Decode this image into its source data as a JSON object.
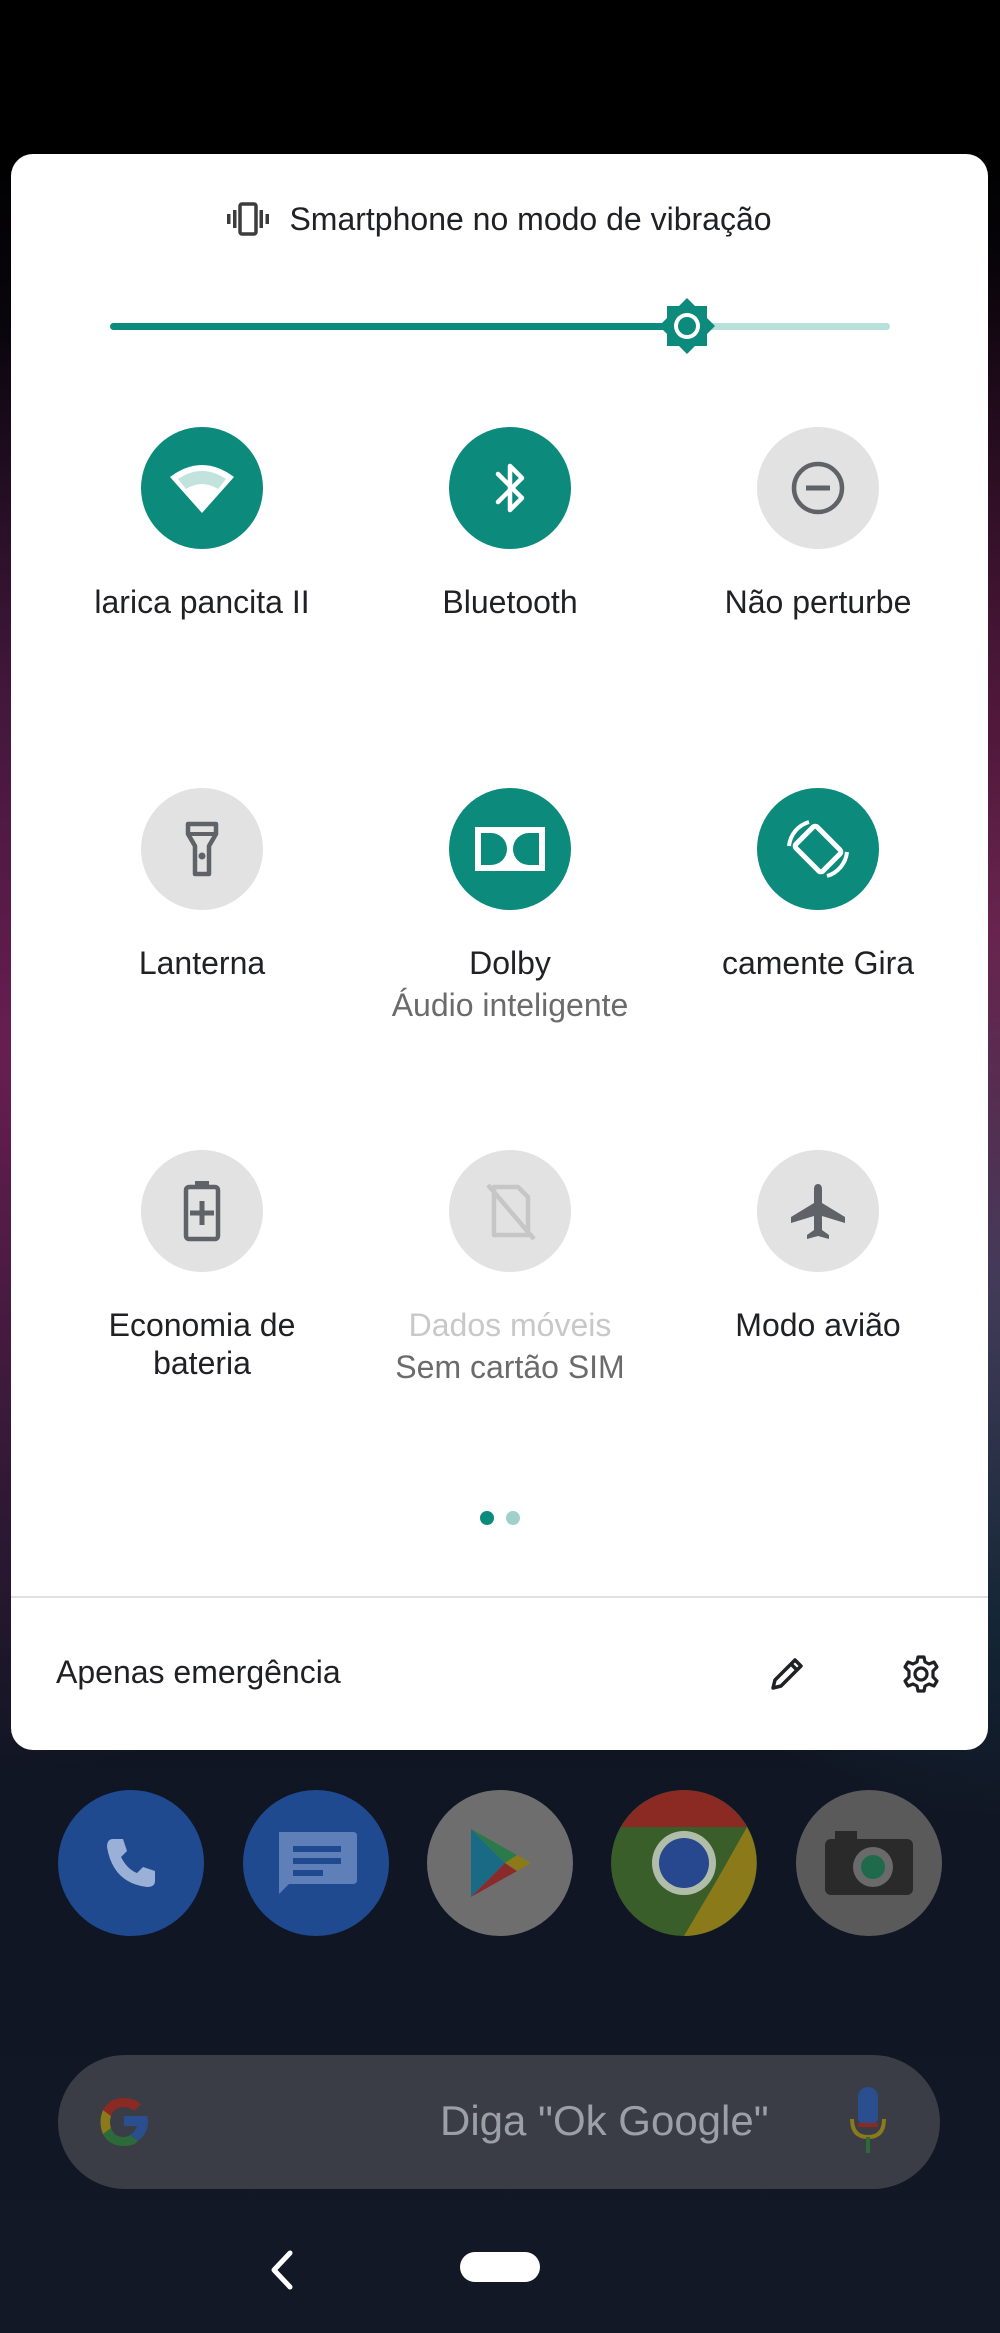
{
  "header": {
    "vibration_text": "Smartphone no modo de vibração",
    "vibration_icon": "vibrate-icon"
  },
  "brightness": {
    "level": 0.74,
    "icon": "brightness-icon"
  },
  "tiles": [
    {
      "label": "larica pancita II",
      "sub": "",
      "state": "on",
      "icon": "wifi-icon"
    },
    {
      "label": "Bluetooth",
      "sub": "",
      "state": "on",
      "icon": "bluetooth-icon"
    },
    {
      "label": "Não perturbe",
      "sub": "",
      "state": "off",
      "icon": "do-not-disturb-icon"
    },
    {
      "label": "Lanterna",
      "sub": "",
      "state": "off",
      "icon": "flashlight-icon"
    },
    {
      "label": "Dolby",
      "sub": "Áudio inteligente",
      "state": "on",
      "icon": "dolby-icon"
    },
    {
      "label": "camente    Gira",
      "sub": "",
      "state": "on",
      "icon": "auto-rotate-icon"
    },
    {
      "label": "Economia de bateria",
      "sub": "",
      "state": "off",
      "icon": "battery-saver-icon"
    },
    {
      "label": "Dados móveis",
      "sub": "Sem cartão SIM",
      "state": "disabled",
      "icon": "mobile-data-off-icon"
    },
    {
      "label": "Modo avião",
      "sub": "",
      "state": "off",
      "icon": "airplane-icon"
    }
  ],
  "pagination": {
    "current": 1,
    "total": 2
  },
  "footer": {
    "text": "Apenas emergência",
    "edit_icon": "edit-icon",
    "settings_icon": "settings-icon"
  },
  "dock": {
    "apps": [
      "phone",
      "messages",
      "play-store",
      "chrome",
      "camera"
    ]
  },
  "search": {
    "hint": "Diga \"Ok Google\""
  },
  "colors": {
    "accent": "#0c8a7c",
    "accent_light": "#b9e1dc",
    "tile_off": "#e2e2e2",
    "panel_bg": "#ffffff"
  }
}
